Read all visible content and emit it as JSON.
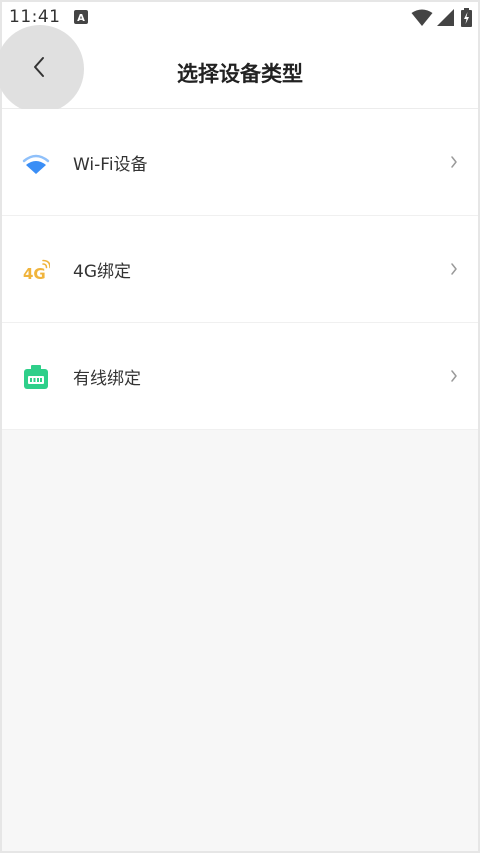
{
  "status_bar": {
    "time": "11:41",
    "notification_icon": "a-notification-icon",
    "wifi_icon": "wifi-icon",
    "signal_icon": "cellular-signal-icon",
    "battery_icon": "battery-charging-icon"
  },
  "header": {
    "back_icon": "chevron-left-icon",
    "title": "选择设备类型"
  },
  "items": [
    {
      "label": "Wi-Fi设备",
      "icon": "wifi-device-icon",
      "icon_color": "#3a8ef6"
    },
    {
      "label": "4G绑定",
      "icon": "4g-icon",
      "icon_color": "#f0b43c"
    },
    {
      "label": "有线绑定",
      "icon": "ethernet-icon",
      "icon_color": "#2fcf8a"
    }
  ],
  "colors": {
    "background": "#f7f7f7",
    "surface": "#ffffff",
    "text_primary": "#333333",
    "chevron": "#9a9a9a"
  }
}
